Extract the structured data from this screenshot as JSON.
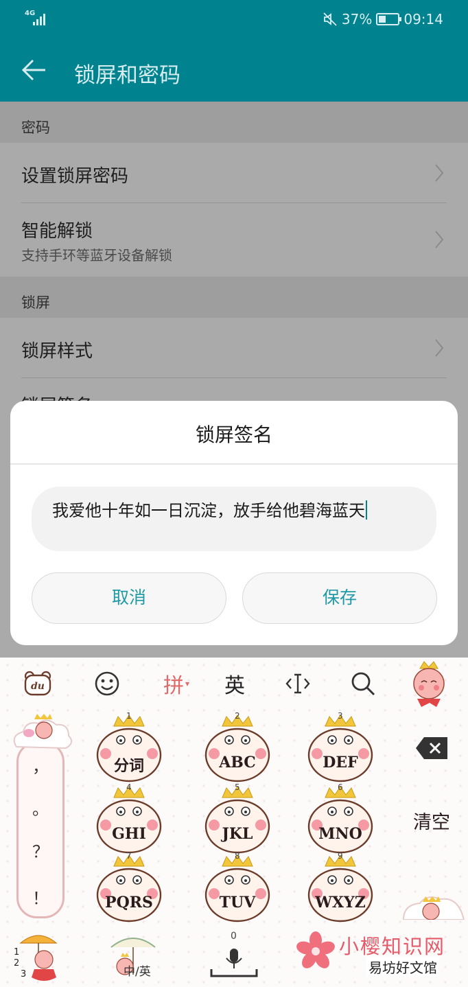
{
  "status_bar": {
    "network": "4G",
    "battery_percent": "37%",
    "battery_level": 0.37,
    "time": "09:14"
  },
  "app_bar": {
    "title": "锁屏和密码",
    "back_icon": "arrow-left-icon"
  },
  "settings": {
    "sections": [
      {
        "header": "密码",
        "items": [
          {
            "title": "设置锁屏密码"
          },
          {
            "title": "智能解锁",
            "subtitle": "支持手环等蓝牙设备解锁"
          }
        ]
      },
      {
        "header": "锁屏",
        "items": [
          {
            "title": "锁屏样式"
          },
          {
            "title": "锁屏签名"
          }
        ]
      }
    ]
  },
  "dialog": {
    "title": "锁屏签名",
    "input_value": "我爱他十年如一日沉淀，放手给他碧海蓝天",
    "cancel_label": "取消",
    "save_label": "保存"
  },
  "keyboard": {
    "toolbar": {
      "logo": "du",
      "emoji_icon": "smiley-icon",
      "pinyin_label": "拼",
      "english_label": "英",
      "cursor_icon": "cursor-move-icon",
      "search_icon": "search-icon"
    },
    "punctuation": [
      "，",
      "。",
      "？",
      "！"
    ],
    "keys": [
      {
        "num": "1",
        "label": "分词"
      },
      {
        "num": "2",
        "label": "ABC"
      },
      {
        "num": "3",
        "label": "DEF"
      },
      {
        "num": "4",
        "label": "GHI"
      },
      {
        "num": "5",
        "label": "JKL"
      },
      {
        "num": "6",
        "label": "MNO"
      },
      {
        "num": "7",
        "label": "PQRS"
      },
      {
        "num": "8",
        "label": "TUV"
      },
      {
        "num": "9",
        "label": "WXYZ"
      }
    ],
    "backspace_icon": "backspace-icon",
    "clear_label": "清空",
    "bottom": {
      "num_labels": [
        "1",
        "2",
        "3"
      ],
      "lang_label": "中/英",
      "zero": "0",
      "mic_icon": "microphone-icon"
    }
  },
  "watermark": {
    "brand": "小樱知识网",
    "site": "易坊好文馆"
  },
  "colors": {
    "teal": "#00838f",
    "accent_text": "#1f9aa5",
    "pink": "#e55b69"
  }
}
